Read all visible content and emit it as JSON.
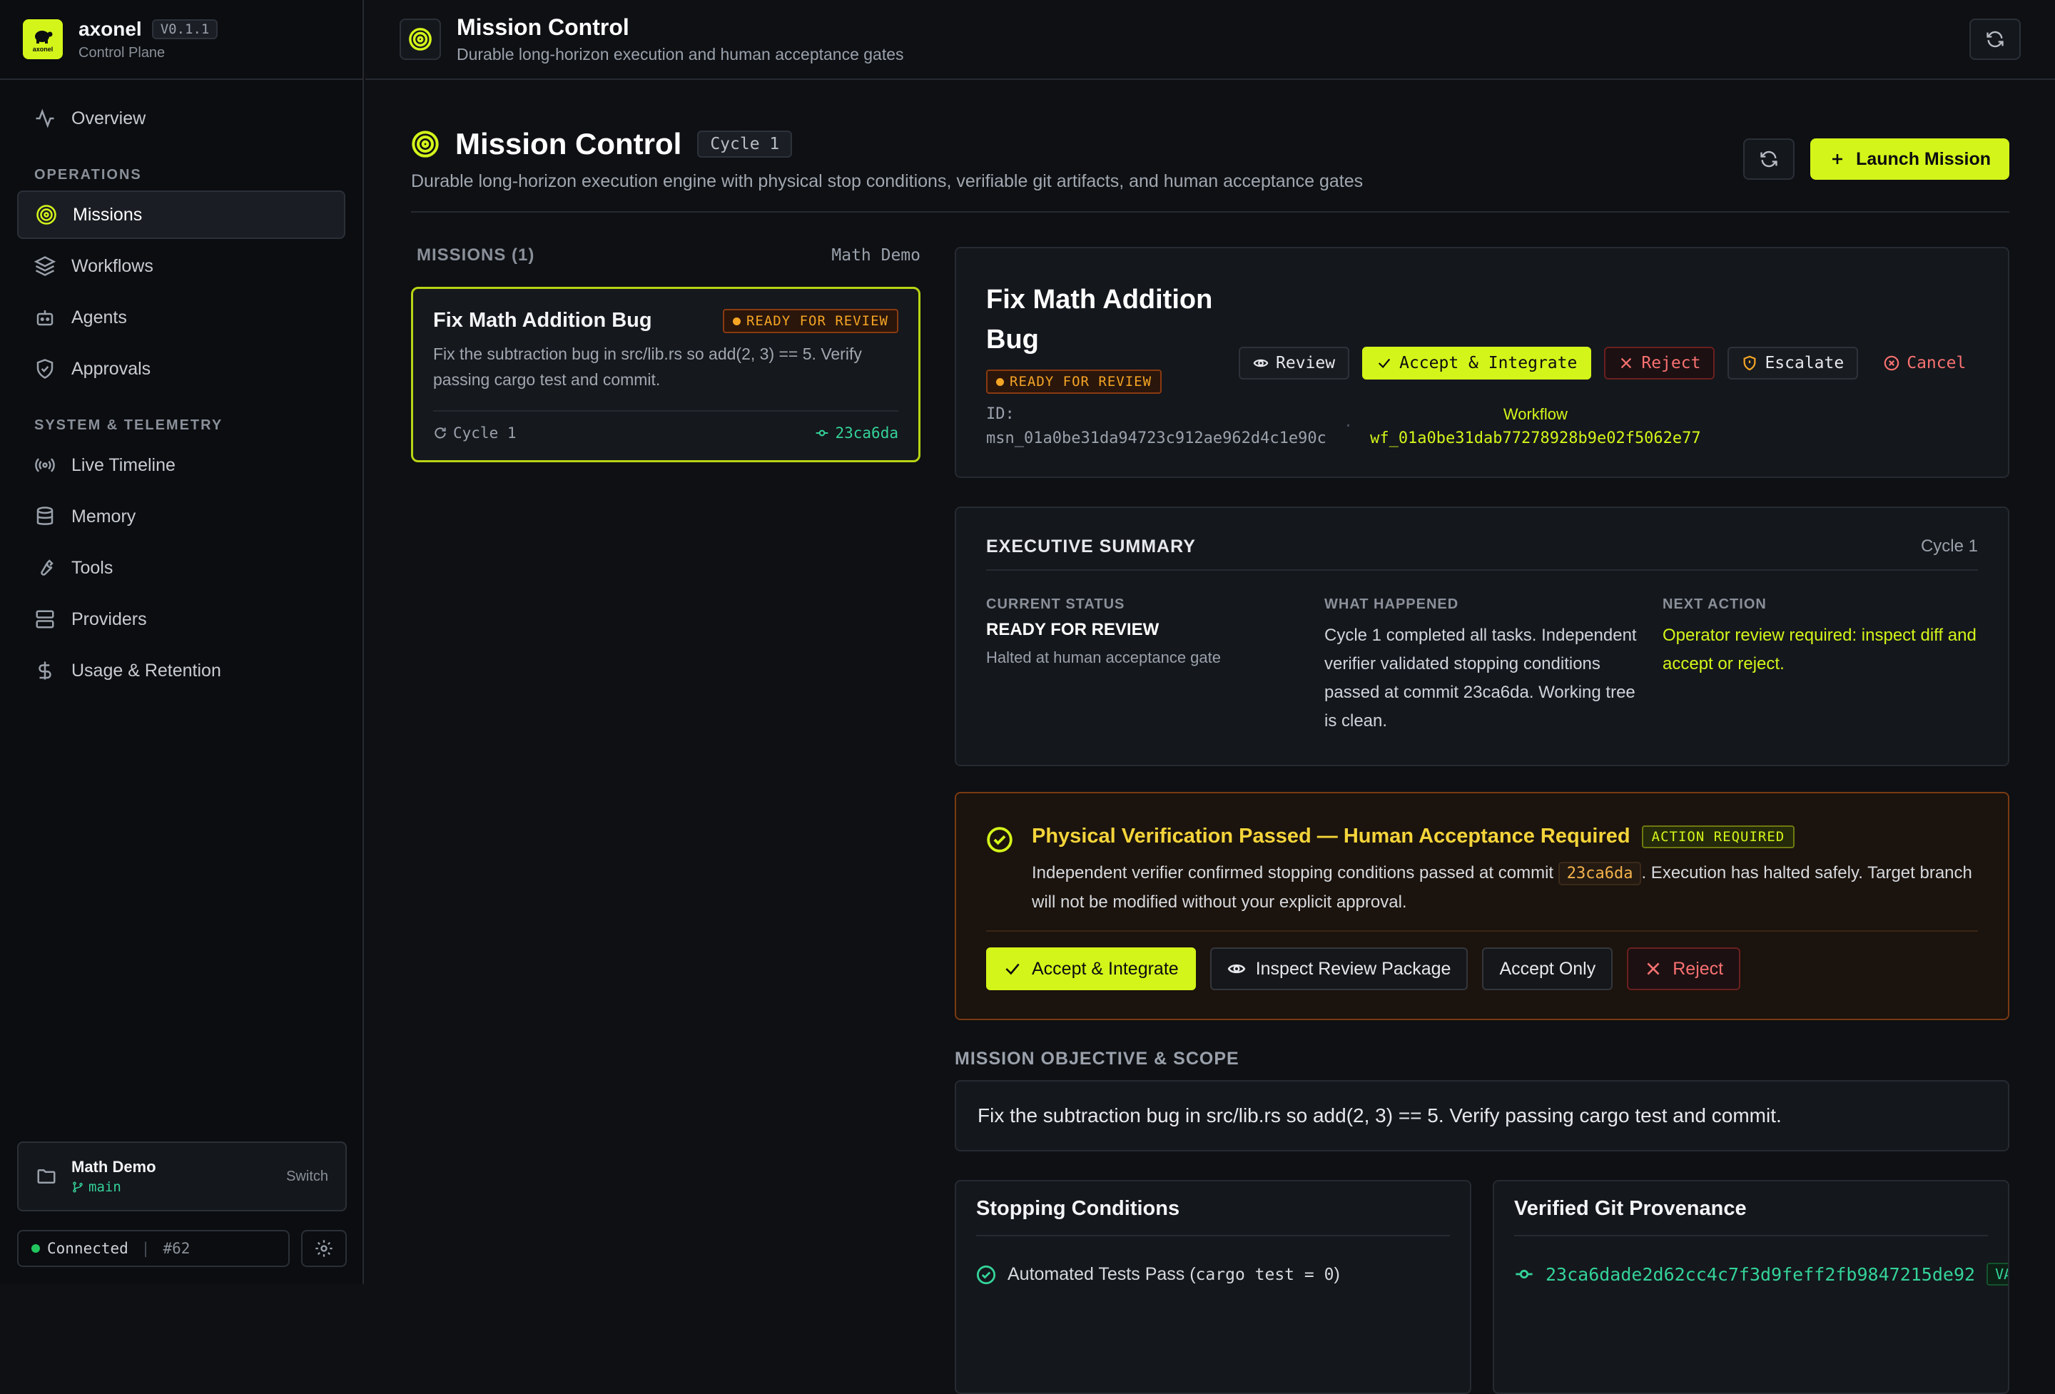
{
  "brand": {
    "name": "axonel",
    "version": "V0.1.1",
    "subtitle": "Control Plane",
    "logo_text": "axonel"
  },
  "nav": {
    "overview": "Overview",
    "section_ops": "OPERATIONS",
    "missions": "Missions",
    "workflows": "Workflows",
    "agents": "Agents",
    "approvals": "Approvals",
    "section_sys": "SYSTEM & TELEMETRY",
    "live_timeline": "Live Timeline",
    "memory": "Memory",
    "tools": "Tools",
    "providers": "Providers",
    "usage": "Usage & Retention"
  },
  "workspace": {
    "name": "Math Demo",
    "branch": "main",
    "switch": "Switch"
  },
  "connection": {
    "status": "Connected",
    "id": "#62"
  },
  "topbar": {
    "title": "Mission Control",
    "subtitle": "Durable long-horizon execution and human acceptance gates"
  },
  "page": {
    "title": "Mission Control",
    "cycle": "Cycle 1",
    "subtitle": "Durable long-horizon execution engine with physical stop conditions, verifiable git artifacts, and human acceptance gates",
    "launch": "Launch Mission"
  },
  "missions": {
    "header": "MISSIONS (1)",
    "filter": "Math Demo",
    "card": {
      "title": "Fix Math Addition Bug",
      "status": "READY FOR REVIEW",
      "desc": "Fix the subtraction bug in src/lib.rs so add(2, 3) == 5. Verify passing cargo test and commit.",
      "cycle": "Cycle 1",
      "commit": "23ca6da"
    }
  },
  "detail": {
    "title": "Fix Math Addition Bug",
    "status": "READY FOR REVIEW",
    "actions": {
      "review": "Review",
      "accept": "Accept & Integrate",
      "reject": "Reject",
      "escalate": "Escalate",
      "cancel": "Cancel"
    },
    "id_label": "ID:",
    "id": "msn_01a0be31da94723c912ae962d4c1e90c",
    "sep": "·",
    "wf_label": "Workflow",
    "wf_id": "wf_01a0be31dab77278928b9e02f5062e77"
  },
  "summary": {
    "title": "EXECUTIVE SUMMARY",
    "cycle": "Cycle 1",
    "status_label": "CURRENT STATUS",
    "status": "READY FOR REVIEW",
    "status_sub": "Halted at human acceptance gate",
    "happened_label": "WHAT HAPPENED",
    "happened": "Cycle 1 completed all tasks. Independent verifier validated stopping conditions passed at commit 23ca6da. Working tree is clean.",
    "next_label": "NEXT ACTION",
    "next": "Operator review required: inspect diff and accept or reject."
  },
  "verify": {
    "title": "Physical Verification Passed — Human Acceptance Required",
    "badge": "ACTION REQUIRED",
    "text_pre": "Independent verifier confirmed stopping conditions passed at commit",
    "commit": "23ca6da",
    "text_post": ". Execution has halted safely. Target branch will not be modified without your explicit approval.",
    "accept": "Accept & Integrate",
    "inspect": "Inspect Review Package",
    "accept_only": "Accept Only",
    "reject": "Reject"
  },
  "objective": {
    "header": "MISSION OBJECTIVE & SCOPE",
    "text": "Fix the subtraction bug in src/lib.rs so add(2, 3) == 5. Verify passing cargo test and commit."
  },
  "stopping": {
    "title": "Stopping Conditions",
    "item": "Automated Tests Pass (",
    "cmd": "cargo test = 0",
    "close": ")"
  },
  "provenance": {
    "title": "Verified Git Provenance",
    "hash": "23ca6dade2d62cc4c7f3d9feff2fb9847215de92",
    "valid": "VALID"
  }
}
